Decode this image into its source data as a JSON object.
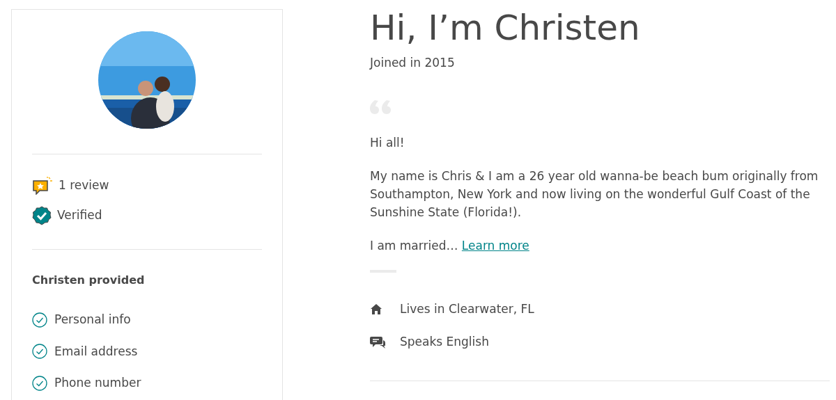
{
  "profile": {
    "badges": [
      {
        "kind": "review",
        "label": "1 review"
      },
      {
        "kind": "verified",
        "label": "Verified"
      }
    ],
    "provided": {
      "title": "Christen provided",
      "items": [
        {
          "label": "Personal info",
          "checked": true
        },
        {
          "label": "Email address",
          "checked": true
        },
        {
          "label": "Phone number",
          "checked": true
        }
      ]
    }
  },
  "intro": {
    "title": "Hi, I’m Christen",
    "joined": "Joined in 2015",
    "bio": [
      "Hi all!",
      "My name is Chris & I am a 26 year old wanna-be beach bum originally from Southampton, New York and now living on the wonderful Gulf Coast of the Sunshine State (Florida!)."
    ],
    "teaser": "I am married…",
    "link": "Learn more",
    "details": [
      {
        "kind": "home",
        "label": "Lives in Clearwater, FL"
      },
      {
        "kind": "language",
        "label": "Speaks English"
      }
    ]
  }
}
